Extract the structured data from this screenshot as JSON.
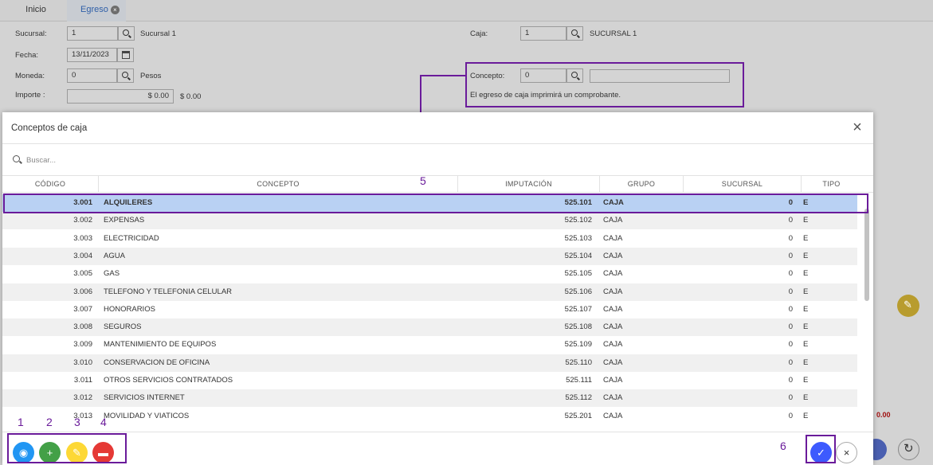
{
  "tabs": [
    {
      "label": "Inicio"
    },
    {
      "label": "Egreso"
    }
  ],
  "form": {
    "sucursal": {
      "label": "Sucursal:",
      "value": "1",
      "name": "Sucursal 1"
    },
    "caja": {
      "label": "Caja:",
      "value": "1",
      "name": "SUCURSAL 1"
    },
    "fecha": {
      "label": "Fecha:",
      "value": "13/11/2023"
    },
    "moneda": {
      "label": "Moneda:",
      "value": "0",
      "name": "Pesos"
    },
    "importe": {
      "label": "Importe :",
      "value": "$ 0.00",
      "text": "$ 0.00"
    },
    "concepto": {
      "label": "Concepto:",
      "value": "0",
      "desc": ""
    },
    "note": "El egreso de caja imprimirá un comprobante.",
    "total_red": "0.00"
  },
  "callouts": {
    "n1": "1",
    "n2": "2",
    "n3": "3",
    "n4": "4",
    "n5": "5",
    "n6": "6"
  },
  "accent_colors": {
    "callout": "#6a1b9a",
    "selected_row": "#b9d1f3",
    "view": "#2196f3",
    "add": "#43a047",
    "edit": "#fdd835",
    "delete": "#e53935",
    "confirm": "#3d5afe"
  },
  "modal": {
    "title": "Conceptos de caja",
    "close_icon": "close-icon",
    "search_placeholder": "Buscar...",
    "columns": [
      "CÓDIGO",
      "CONCEPTO",
      "IMPUTACIÓN",
      "GRUPO",
      "SUCURSAL",
      "TIPO"
    ],
    "rows": [
      {
        "codigo": "3.001",
        "concepto": "ALQUILERES",
        "imputacion": "525.101",
        "grupo": "CAJA",
        "sucursal": "0",
        "tipo": "E"
      },
      {
        "codigo": "3.002",
        "concepto": "EXPENSAS",
        "imputacion": "525.102",
        "grupo": "CAJA",
        "sucursal": "0",
        "tipo": "E"
      },
      {
        "codigo": "3.003",
        "concepto": "ELECTRICIDAD",
        "imputacion": "525.103",
        "grupo": "CAJA",
        "sucursal": "0",
        "tipo": "E"
      },
      {
        "codigo": "3.004",
        "concepto": "AGUA",
        "imputacion": "525.104",
        "grupo": "CAJA",
        "sucursal": "0",
        "tipo": "E"
      },
      {
        "codigo": "3.005",
        "concepto": "GAS",
        "imputacion": "525.105",
        "grupo": "CAJA",
        "sucursal": "0",
        "tipo": "E"
      },
      {
        "codigo": "3.006",
        "concepto": "TELEFONO Y TELEFONIA CELULAR",
        "imputacion": "525.106",
        "grupo": "CAJA",
        "sucursal": "0",
        "tipo": "E"
      },
      {
        "codigo": "3.007",
        "concepto": "HONORARIOS",
        "imputacion": "525.107",
        "grupo": "CAJA",
        "sucursal": "0",
        "tipo": "E"
      },
      {
        "codigo": "3.008",
        "concepto": "SEGUROS",
        "imputacion": "525.108",
        "grupo": "CAJA",
        "sucursal": "0",
        "tipo": "E"
      },
      {
        "codigo": "3.009",
        "concepto": "MANTENIMIENTO DE EQUIPOS",
        "imputacion": "525.109",
        "grupo": "CAJA",
        "sucursal": "0",
        "tipo": "E"
      },
      {
        "codigo": "3.010",
        "concepto": "CONSERVACION DE OFICINA",
        "imputacion": "525.110",
        "grupo": "CAJA",
        "sucursal": "0",
        "tipo": "E"
      },
      {
        "codigo": "3.011",
        "concepto": "OTROS SERVICIOS CONTRATADOS",
        "imputacion": "525.111",
        "grupo": "CAJA",
        "sucursal": "0",
        "tipo": "E"
      },
      {
        "codigo": "3.012",
        "concepto": "SERVICIOS INTERNET",
        "imputacion": "525.112",
        "grupo": "CAJA",
        "sucursal": "0",
        "tipo": "E"
      },
      {
        "codigo": "3.013",
        "concepto": "MOVILIDAD Y VIATICOS",
        "imputacion": "525.201",
        "grupo": "CAJA",
        "sucursal": "0",
        "tipo": "E"
      }
    ],
    "footer": {
      "view_icon": "eye-icon",
      "add_icon": "plus-icon",
      "edit_icon": "pencil-icon",
      "delete_icon": "trash-icon",
      "confirm_icon": "check-icon",
      "cancel_icon": "close-icon"
    }
  }
}
